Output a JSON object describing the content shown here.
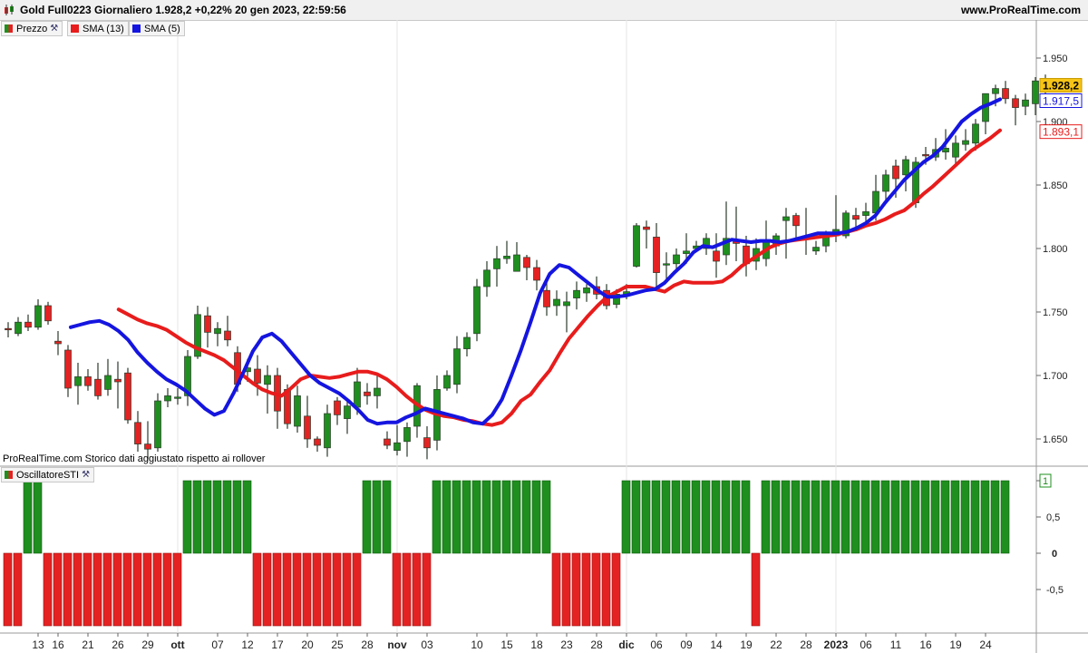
{
  "header": {
    "title": "Gold Full0223 Giornaliero 1.928,2 +0,22% 20 gen 2023, 22:59:56",
    "site": "www.ProRealTime.com"
  },
  "legend": {
    "price_label": "Prezzo",
    "sma13_label": "SMA (13)",
    "sma5_label": "SMA (5)",
    "oscillator_label": "OscillatoreSTI"
  },
  "note": "ProRealTime.com  Storico dati aggiustato rispetto ai rollover",
  "colors": {
    "up": "#1f8f1f",
    "down": "#e52222",
    "sma13": "#e81c1c",
    "sma5": "#1515e0",
    "price_tag": "#f6c417"
  },
  "chart_data": [
    {
      "type": "candlestick",
      "title": "Gold Full0223 Giornaliero",
      "ylim": [
        1630,
        1965
      ],
      "y_ticks": [
        "1.650",
        "1.700",
        "1.750",
        "1.800",
        "1.850",
        "1.900",
        "1.950"
      ],
      "y_tick_values": [
        1650,
        1700,
        1750,
        1800,
        1850,
        1900,
        1950
      ],
      "price_tags": [
        {
          "label": "1.928,2",
          "value": 1928.2,
          "series": "Prezzo"
        },
        {
          "label": "1.917,5",
          "value": 1917.5,
          "series": "SMA (5)"
        },
        {
          "label": "1.893,1",
          "value": 1893.1,
          "series": "SMA (13)"
        }
      ],
      "x_tick_labels": [
        "13",
        "16",
        "21",
        "26",
        "29",
        "ott",
        "07",
        "12",
        "17",
        "20",
        "25",
        "28",
        "nov",
        "03",
        "10",
        "15",
        "18",
        "23",
        "28",
        "dic",
        "06",
        "09",
        "14",
        "19",
        "22",
        "28",
        "2023",
        "06",
        "11",
        "16",
        "19",
        "24"
      ],
      "x_tick_index": [
        3,
        5,
        8,
        11,
        14,
        17,
        21,
        24,
        27,
        30,
        33,
        36,
        39,
        42,
        47,
        50,
        53,
        56,
        59,
        62,
        65,
        68,
        71,
        74,
        77,
        80,
        83,
        86,
        89,
        92,
        95,
        98
      ],
      "candles": [
        [
          1737,
          1742,
          1730,
          1736
        ],
        [
          1733,
          1746,
          1731,
          1742
        ],
        [
          1742,
          1748,
          1735,
          1738
        ],
        [
          1738,
          1760,
          1736,
          1755
        ],
        [
          1755,
          1758,
          1740,
          1743
        ],
        [
          1727,
          1735,
          1716,
          1725
        ],
        [
          1720,
          1724,
          1683,
          1690
        ],
        [
          1692,
          1710,
          1677,
          1699
        ],
        [
          1699,
          1705,
          1688,
          1692
        ],
        [
          1697,
          1710,
          1681,
          1684
        ],
        [
          1689,
          1713,
          1684,
          1700
        ],
        [
          1697,
          1711,
          1674,
          1695
        ],
        [
          1702,
          1706,
          1662,
          1665
        ],
        [
          1663,
          1672,
          1640,
          1646
        ],
        [
          1646,
          1664,
          1634,
          1642
        ],
        [
          1643,
          1686,
          1640,
          1680
        ],
        [
          1680,
          1690,
          1675,
          1684
        ],
        [
          1682,
          1690,
          1677,
          1683
        ],
        [
          1684,
          1720,
          1676,
          1715
        ],
        [
          1715,
          1755,
          1713,
          1748
        ],
        [
          1747,
          1754,
          1722,
          1734
        ],
        [
          1733,
          1742,
          1723,
          1737
        ],
        [
          1735,
          1747,
          1723,
          1728
        ],
        [
          1718,
          1723,
          1687,
          1693
        ],
        [
          1703,
          1713,
          1695,
          1706
        ],
        [
          1705,
          1716,
          1684,
          1694
        ],
        [
          1693,
          1708,
          1670,
          1700
        ],
        [
          1700,
          1706,
          1658,
          1672
        ],
        [
          1689,
          1693,
          1658,
          1662
        ],
        [
          1660,
          1692,
          1655,
          1684
        ],
        [
          1668,
          1684,
          1643,
          1650
        ],
        [
          1650,
          1652,
          1640,
          1645
        ],
        [
          1643,
          1677,
          1636,
          1670
        ],
        [
          1680,
          1683,
          1661,
          1669
        ],
        [
          1666,
          1682,
          1654,
          1676
        ],
        [
          1675,
          1706,
          1669,
          1695
        ],
        [
          1687,
          1694,
          1677,
          1684
        ],
        [
          1684,
          1701,
          1674,
          1690
        ],
        [
          1650,
          1656,
          1642,
          1645
        ],
        [
          1641,
          1661,
          1637,
          1647
        ],
        [
          1648,
          1663,
          1636,
          1659
        ],
        [
          1660,
          1694,
          1651,
          1692
        ],
        [
          1651,
          1660,
          1634,
          1643
        ],
        [
          1649,
          1700,
          1641,
          1689
        ],
        [
          1690,
          1704,
          1688,
          1700
        ],
        [
          1693,
          1731,
          1686,
          1721
        ],
        [
          1721,
          1734,
          1715,
          1730
        ],
        [
          1733,
          1776,
          1727,
          1770
        ],
        [
          1770,
          1790,
          1762,
          1783
        ],
        [
          1784,
          1802,
          1770,
          1792
        ],
        [
          1792,
          1806,
          1788,
          1794
        ],
        [
          1782,
          1805,
          1782,
          1795
        ],
        [
          1793,
          1795,
          1775,
          1785
        ],
        [
          1785,
          1791,
          1767,
          1775
        ],
        [
          1767,
          1774,
          1747,
          1754
        ],
        [
          1755,
          1767,
          1747,
          1760
        ],
        [
          1755,
          1766,
          1734,
          1758
        ],
        [
          1761,
          1774,
          1752,
          1767
        ],
        [
          1765,
          1772,
          1758,
          1769
        ],
        [
          1770,
          1778,
          1760,
          1764
        ],
        [
          1767,
          1772,
          1752,
          1755
        ],
        [
          1756,
          1768,
          1753,
          1764
        ],
        [
          1764,
          1772,
          1760,
          1766
        ],
        [
          1786,
          1820,
          1785,
          1818
        ],
        [
          1817,
          1822,
          1800,
          1815
        ],
        [
          1809,
          1820,
          1770,
          1781
        ],
        [
          1787,
          1797,
          1776,
          1788
        ],
        [
          1788,
          1800,
          1783,
          1795
        ],
        [
          1796,
          1812,
          1788,
          1798
        ],
        [
          1800,
          1806,
          1798,
          1802
        ],
        [
          1800,
          1812,
          1795,
          1808
        ],
        [
          1798,
          1812,
          1777,
          1790
        ],
        [
          1795,
          1837,
          1787,
          1808
        ],
        [
          1806,
          1833,
          1790,
          1804
        ],
        [
          1802,
          1810,
          1778,
          1788
        ],
        [
          1790,
          1808,
          1783,
          1800
        ],
        [
          1792,
          1822,
          1786,
          1806
        ],
        [
          1802,
          1812,
          1795,
          1810
        ],
        [
          1822,
          1832,
          1792,
          1825
        ],
        [
          1826,
          1828,
          1806,
          1818
        ],
        [
          1810,
          1832,
          1795,
          1808
        ],
        [
          1798,
          1806,
          1795,
          1801
        ],
        [
          1802,
          1814,
          1797,
          1809
        ],
        [
          1810,
          1842,
          1805,
          1815
        ],
        [
          1810,
          1830,
          1808,
          1828
        ],
        [
          1826,
          1832,
          1816,
          1823
        ],
        [
          1826,
          1836,
          1818,
          1829
        ],
        [
          1828,
          1858,
          1822,
          1845
        ],
        [
          1845,
          1862,
          1838,
          1858
        ],
        [
          1865,
          1870,
          1840,
          1855
        ],
        [
          1858,
          1873,
          1845,
          1870
        ],
        [
          1836,
          1872,
          1832,
          1868
        ],
        [
          1874,
          1880,
          1866,
          1873
        ],
        [
          1872,
          1887,
          1869,
          1878
        ],
        [
          1876,
          1894,
          1870,
          1879
        ],
        [
          1872,
          1889,
          1866,
          1883
        ],
        [
          1882,
          1894,
          1877,
          1885
        ],
        [
          1883,
          1902,
          1877,
          1898
        ],
        [
          1900,
          1922,
          1890,
          1922
        ],
        [
          1922,
          1929,
          1912,
          1926
        ],
        [
          1926,
          1932,
          1914,
          1918
        ],
        [
          1918,
          1921,
          1897,
          1911
        ],
        [
          1912,
          1922,
          1905,
          1917
        ],
        [
          1914,
          1935,
          1905,
          1932
        ],
        [
          1933,
          1937,
          1920,
          1928.2
        ]
      ],
      "series": [
        {
          "name": "SMA (13)",
          "values": [
            1752,
            1748,
            1744,
            1741,
            1739,
            1736,
            1731,
            1726,
            1722,
            1719,
            1716,
            1712,
            1706,
            1700,
            1694,
            1689,
            1686,
            1684,
            1690,
            1697,
            1700,
            1699,
            1698,
            1699,
            1701,
            1703,
            1703,
            1701,
            1697,
            1691,
            1684,
            1678,
            1673,
            1670,
            1668,
            1667,
            1665,
            1664,
            1662,
            1661,
            1663,
            1670,
            1680,
            1685,
            1695,
            1704,
            1717,
            1729,
            1738,
            1747,
            1755,
            1762,
            1766,
            1770,
            1770,
            1770,
            1768,
            1766,
            1771,
            1774,
            1773,
            1773,
            1773,
            1774,
            1779,
            1786,
            1791,
            1796,
            1801,
            1804,
            1806,
            1807,
            1808,
            1809,
            1810,
            1811,
            1813,
            1815,
            1818,
            1820,
            1823,
            1827,
            1830,
            1836,
            1843,
            1849,
            1856,
            1863,
            1870,
            1877,
            1882,
            1887,
            1893.1
          ]
        },
        {
          "name": "SMA (5)",
          "values": [
            1738,
            1740,
            1742,
            1743,
            1740,
            1735,
            1728,
            1718,
            1710,
            1703,
            1697,
            1693,
            1688,
            1681,
            1674,
            1669,
            1672,
            1686,
            1702,
            1719,
            1730,
            1733,
            1727,
            1718,
            1709,
            1700,
            1694,
            1690,
            1686,
            1680,
            1673,
            1665,
            1662,
            1663,
            1663,
            1667,
            1670,
            1674,
            1672,
            1670,
            1668,
            1666,
            1663,
            1662,
            1669,
            1681,
            1700,
            1720,
            1742,
            1765,
            1780,
            1787,
            1785,
            1779,
            1773,
            1767,
            1762,
            1762,
            1763,
            1765,
            1767,
            1768,
            1773,
            1781,
            1788,
            1797,
            1802,
            1801,
            1804,
            1807,
            1806,
            1805,
            1806,
            1806,
            1805,
            1806,
            1808,
            1810,
            1812,
            1812,
            1812,
            1813,
            1816,
            1820,
            1826,
            1836,
            1845,
            1854,
            1861,
            1868,
            1873,
            1880,
            1890,
            1900,
            1906,
            1911,
            1914,
            1917.5
          ]
        }
      ]
    },
    {
      "type": "bar",
      "title": "OscillatoreSTI",
      "ylim": [
        -1,
        1
      ],
      "y_ticks": [
        "1",
        "0,5",
        "0",
        "-0,5"
      ],
      "y_tick_values": [
        1,
        0.5,
        0,
        -0.5
      ],
      "values": [
        -1,
        -1,
        1,
        1,
        -1,
        -1,
        -1,
        -1,
        -1,
        -1,
        -1,
        -1,
        -1,
        -1,
        -1,
        -1,
        -1,
        -1,
        1,
        1,
        1,
        1,
        1,
        1,
        1,
        -1,
        -1,
        -1,
        -1,
        -1,
        -1,
        -1,
        -1,
        -1,
        -1,
        -1,
        1,
        1,
        1,
        -1,
        -1,
        -1,
        -1,
        1,
        1,
        1,
        1,
        1,
        1,
        1,
        1,
        1,
        1,
        1,
        1,
        -1,
        -1,
        -1,
        -1,
        -1,
        -1,
        -1,
        1,
        1,
        1,
        1,
        1,
        1,
        1,
        1,
        1,
        1,
        1,
        1,
        1,
        -1,
        1,
        1,
        1,
        1,
        1,
        1,
        1,
        1,
        1,
        1,
        1,
        1,
        1,
        1,
        1,
        1,
        1,
        1,
        1,
        1,
        1,
        1,
        1,
        1,
        1
      ]
    }
  ]
}
